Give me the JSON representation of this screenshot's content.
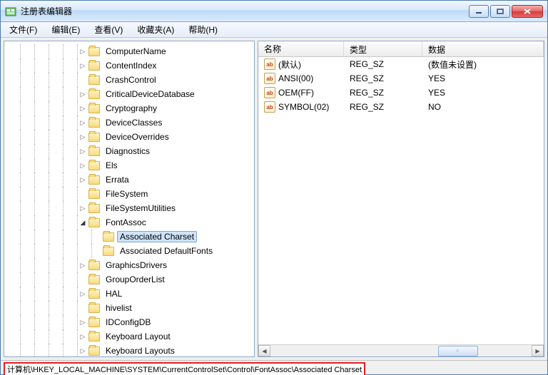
{
  "window": {
    "title": "注册表编辑器"
  },
  "menu": {
    "file": "文件(F)",
    "edit": "编辑(E)",
    "view": "查看(V)",
    "favorites": "收藏夹(A)",
    "help": "帮助(H)"
  },
  "tree": {
    "items": [
      {
        "label": "ComputerName",
        "expander": "▷"
      },
      {
        "label": "ContentIndex",
        "expander": "▷"
      },
      {
        "label": "CrashControl",
        "expander": ""
      },
      {
        "label": "CriticalDeviceDatabase",
        "expander": "▷"
      },
      {
        "label": "Cryptography",
        "expander": "▷"
      },
      {
        "label": "DeviceClasses",
        "expander": "▷"
      },
      {
        "label": "DeviceOverrides",
        "expander": "▷"
      },
      {
        "label": "Diagnostics",
        "expander": "▷"
      },
      {
        "label": "Els",
        "expander": "▷"
      },
      {
        "label": "Errata",
        "expander": "▷"
      },
      {
        "label": "FileSystem",
        "expander": ""
      },
      {
        "label": "FileSystemUtilities",
        "expander": "▷"
      },
      {
        "label": "FontAssoc",
        "expander": "◢",
        "expanded": true,
        "children": [
          {
            "label": "Associated Charset",
            "selected": true
          },
          {
            "label": "Associated DefaultFonts"
          }
        ]
      },
      {
        "label": "GraphicsDrivers",
        "expander": "▷"
      },
      {
        "label": "GroupOrderList",
        "expander": ""
      },
      {
        "label": "HAL",
        "expander": "▷"
      },
      {
        "label": "hivelist",
        "expander": ""
      },
      {
        "label": "IDConfigDB",
        "expander": "▷"
      },
      {
        "label": "Keyboard Layout",
        "expander": "▷"
      },
      {
        "label": "Keyboard Layouts",
        "expander": "▷"
      }
    ]
  },
  "list": {
    "headers": {
      "name": "名称",
      "type": "类型",
      "data": "数据"
    },
    "rows": [
      {
        "name": "(默认)",
        "type": "REG_SZ",
        "data": "(数值未设置)"
      },
      {
        "name": "ANSI(00)",
        "type": "REG_SZ",
        "data": "YES"
      },
      {
        "name": "OEM(FF)",
        "type": "REG_SZ",
        "data": "YES"
      },
      {
        "name": "SYMBOL(02)",
        "type": "REG_SZ",
        "data": "NO"
      }
    ]
  },
  "statusbar": {
    "path": "计算机\\HKEY_LOCAL_MACHINE\\SYSTEM\\CurrentControlSet\\Control\\FontAssoc\\Associated Charset"
  }
}
